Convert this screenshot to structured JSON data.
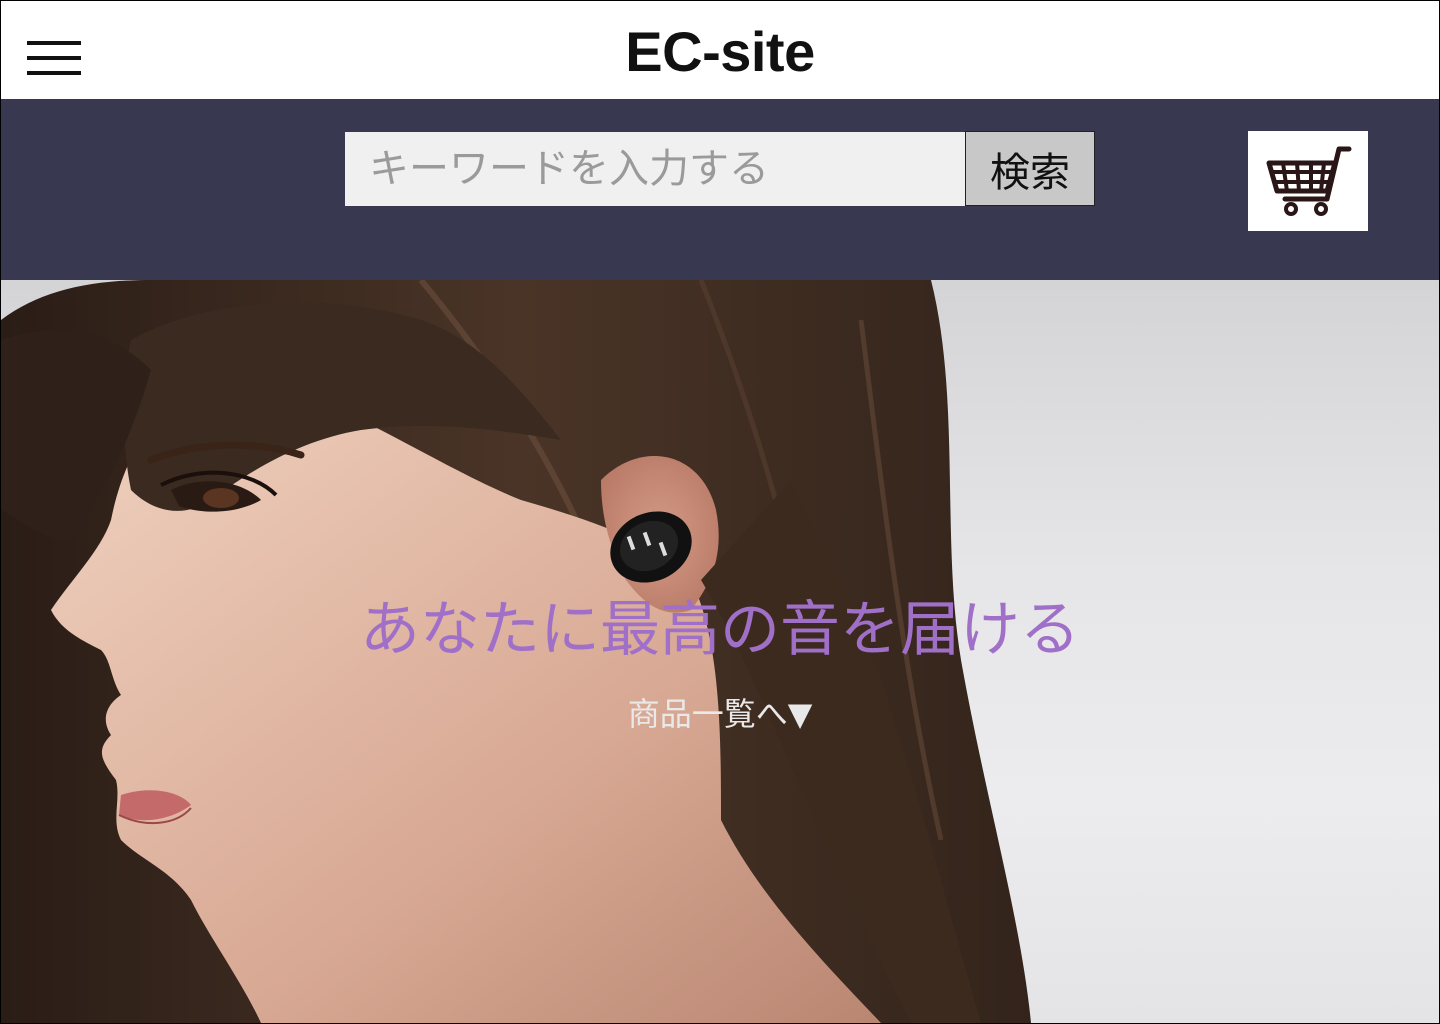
{
  "header": {
    "title": "EC-site",
    "menu_icon": "hamburger-menu-icon"
  },
  "search": {
    "placeholder": "キーワードを入力する",
    "value": "",
    "button_label": "検索"
  },
  "cart": {
    "icon": "shopping-cart-icon"
  },
  "hero": {
    "headline": "あなたに最高の音を届ける",
    "link_label": "商品一覧へ▼",
    "colors": {
      "headline": "#a070c8",
      "band": "#383851"
    }
  }
}
